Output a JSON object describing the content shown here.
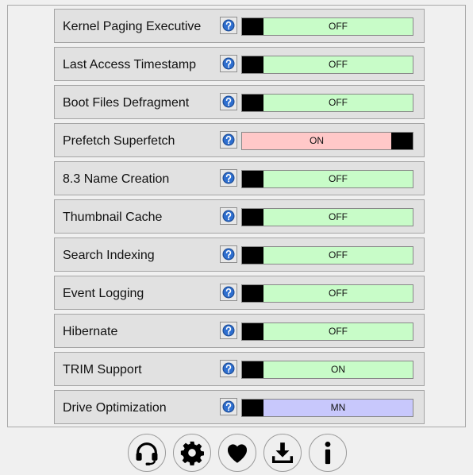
{
  "settings": [
    {
      "label": "Kernel Paging Executive",
      "state": "OFF",
      "knob": "left",
      "color": "#c8fcc8"
    },
    {
      "label": "Last Access Timestamp",
      "state": "OFF",
      "knob": "left",
      "color": "#c8fcc8"
    },
    {
      "label": "Boot Files Defragment",
      "state": "OFF",
      "knob": "left",
      "color": "#c8fcc8"
    },
    {
      "label": "Prefetch Superfetch",
      "state": "ON",
      "knob": "right",
      "color": "#ffc8c8"
    },
    {
      "label": "8.3 Name Creation",
      "state": "OFF",
      "knob": "left",
      "color": "#c8fcc8"
    },
    {
      "label": "Thumbnail Cache",
      "state": "OFF",
      "knob": "left",
      "color": "#c8fcc8"
    },
    {
      "label": "Search Indexing",
      "state": "OFF",
      "knob": "left",
      "color": "#c8fcc8"
    },
    {
      "label": "Event Logging",
      "state": "OFF",
      "knob": "left",
      "color": "#c8fcc8"
    },
    {
      "label": "Hibernate",
      "state": "OFF",
      "knob": "left",
      "color": "#c8fcc8"
    },
    {
      "label": "TRIM Support",
      "state": "ON",
      "knob": "left",
      "color": "#c8fcc8"
    },
    {
      "label": "Drive Optimization",
      "state": "MN",
      "knob": "left",
      "color": "#c8c8fc"
    }
  ],
  "icons": {
    "help": "help-icon",
    "bottom": [
      "headset-icon",
      "gear-icon",
      "heart-icon",
      "download-icon",
      "info-icon"
    ]
  }
}
